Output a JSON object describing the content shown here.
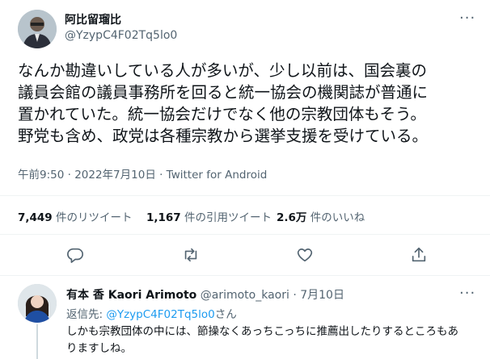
{
  "tweet": {
    "author_name": "阿比留瑠比",
    "author_handle": "@YzypC4F02Tq5lo0",
    "lines": [
      "なんか勘違いしている人が多いが、少し以前は、国会裏の",
      "議員会館の議員事務所を回ると統一協会の機関誌が普通に",
      "置かれていた。統一協会だけでなく他の宗教団体もそう。",
      "野党も含め、政党は各種宗教から選挙支援を受けている。"
    ],
    "meta": "午前9:50 · 2022年7月10日 · Twitter for Android",
    "stats": {
      "retweets_value": "7,449",
      "retweets_label": "件のリツイート",
      "quotes_value": "1,167",
      "quotes_label": "件の引用ツイート",
      "likes_value": "2.6万",
      "likes_label": "件のいいね"
    },
    "more_glyph": "···"
  },
  "reply": {
    "author_name": "有本 香 Kaori Arimoto",
    "author_handle": "@arimoto_kaori",
    "date": "· 7月10日",
    "replying_prefix": "返信先: ",
    "replying_handle": "@YzypC4F02Tq5lo0",
    "replying_suffix": "さん",
    "lines": [
      "しかも宗教団体の中には、節操なくあっちこっちに推薦出したりするところもあ",
      "りますしね。"
    ],
    "more_glyph": "···"
  },
  "icons": [
    "reply-icon",
    "retweet-icon",
    "like-icon",
    "share-icon",
    "more-icon"
  ],
  "colors": {
    "text": "#0f1419",
    "muted": "#536471",
    "link": "#1d9bf0",
    "divider": "#eff3f4"
  }
}
